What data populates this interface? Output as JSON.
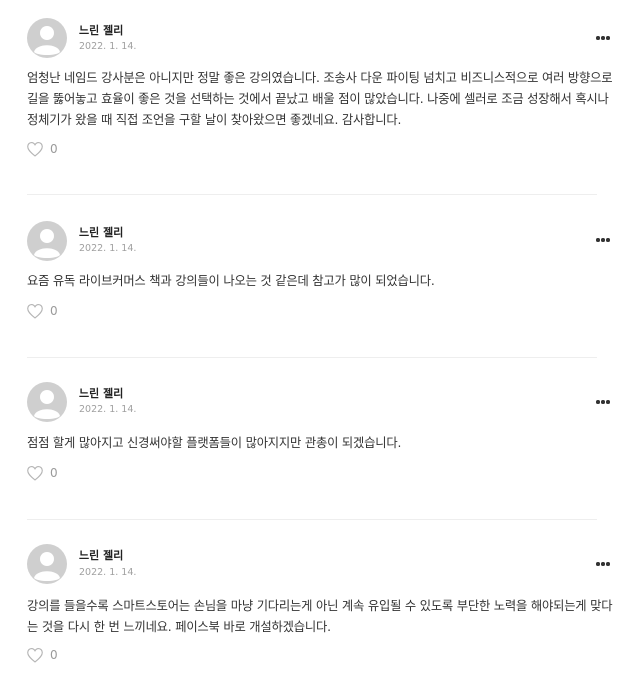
{
  "comments": [
    {
      "author": "느린 젤리",
      "date": "2022. 1. 14.",
      "text": "엄청난 네임드 강사분은 아니지만 정말 좋은 강의였습니다. 조송사 다운 파이팅 넘치고 비즈니스적으로 여러 방향으로 길을 뚫어놓고 효율이 좋은 것을 선택하는 것에서 끝났고 배울 점이 많았습니다. 나중에 셀러로 조금 성장해서 혹시나 정체기가 왔을 때 직접 조언을 구할 날이 찾아왔으면 좋겠네요. 감사합니다.",
      "likes": "0"
    },
    {
      "author": "느린 젤리",
      "date": "2022. 1. 14.",
      "text": "요즘 유독 라이브커머스 책과 강의들이 나오는 것 같은데 참고가 많이 되었습니다.",
      "likes": "0"
    },
    {
      "author": "느린 젤리",
      "date": "2022. 1. 14.",
      "text": "점점 할게 많아지고 신경써야할 플랫폼들이 많아지지만 관총이 되겠습니다.",
      "likes": "0"
    },
    {
      "author": "느린 젤리",
      "date": "2022. 1. 14.",
      "text": "강의를 들을수록 스마트스토어는 손님을 마냥 기다리는게 아닌 계속 유입될 수 있도록 부단한 노력을 해야되는게 맞다는 것을 다시 한 번 느끼네요. 페이스북 바로 개설하겠습니다.",
      "likes": "0"
    }
  ],
  "colors": {
    "avatar": "#cfcfcf",
    "date": "#a0a0a0",
    "likeCount": "#9a9a9a",
    "divider": "#eeeeee"
  },
  "icons": {
    "avatar": "default-user-avatar-icon",
    "more": "more-dots-icon",
    "like": "heart-outline-icon"
  }
}
